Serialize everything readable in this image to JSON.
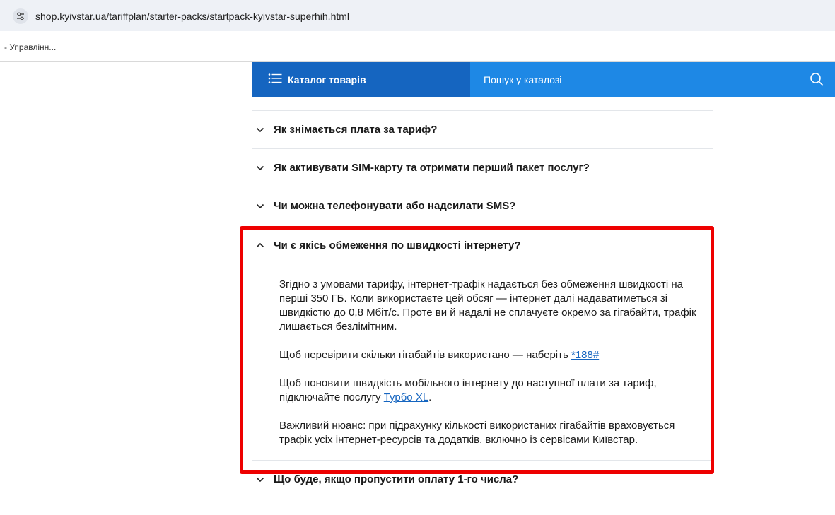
{
  "browser": {
    "url": "shop.kyivstar.ua/tariffplan/starter-packs/startpack-kyivstar-superhih.html",
    "bookmark": "- Управлінн..."
  },
  "header": {
    "catalog_label": "Каталог товарів",
    "search_placeholder": "Пошук у каталозі",
    "bg_color": "#1e88e5",
    "catalog_bg_color": "#1565c0"
  },
  "faq": {
    "q1": "Як знімається плата за тариф?",
    "q2": "Як активувати SIM-карту та отримати перший пакет послуг?",
    "q3": "Чи можна телефонувати або надсилати SMS?",
    "q4": "Чи є якісь обмеження по швидкості інтернету?",
    "a4_p1": "Згідно з умовами тарифу, інтернет-трафік надається без обмеження швидкості на перші 350 ГБ. Коли використаєте цей обсяг — інтернет далі надаватиметься зі швидкістю до 0,8 Мбіт/с. Проте ви й надалі не сплачуєте окремо за гігабайти, трафік лишається безлімітним.",
    "a4_p2_text": "Щоб перевірити скільки гігабайтів використано — наберіть ",
    "a4_p2_link": "*188#",
    "a4_p3_text": "Щоб поновити швидкість мобільного інтернету до наступної плати за тариф, підключайте послугу ",
    "a4_p3_link": "Турбо XL",
    "a4_p3_end": ".",
    "a4_p4": "Важливий нюанс: при підрахунку кількості використаних гігабайтів враховується трафік усіх інтернет-ресурсів та додатків, включно із сервісами Київстар.",
    "q5": "Що буде, якщо пропустити оплату 1-го числа?"
  },
  "colors": {
    "highlight": "#ee0000",
    "link": "#1565c0"
  }
}
